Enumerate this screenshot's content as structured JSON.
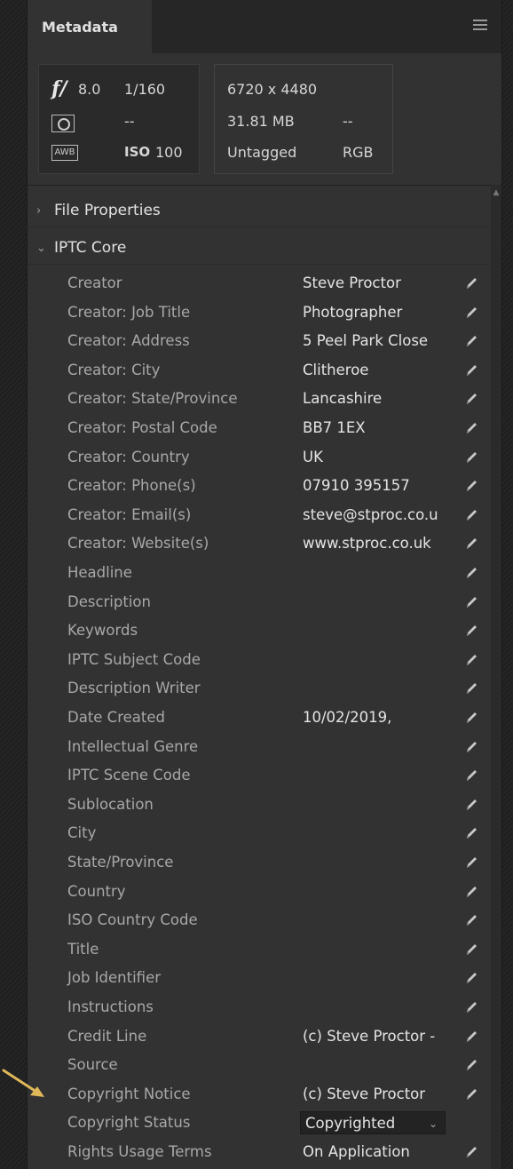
{
  "panel": {
    "tab_label": "Metadata",
    "menu_icon": "hamburger-menu-icon"
  },
  "summary": {
    "exif": {
      "aperture_symbol": "f/",
      "aperture": "8.0",
      "shutter": "1/160",
      "metering": "--",
      "white_balance": "AWB",
      "iso_label": "ISO",
      "iso": "100"
    },
    "file": {
      "dimensions": "6720 x 4480",
      "size": "31.81 MB",
      "size_extra": "--",
      "profile": "Untagged",
      "color_mode": "RGB"
    }
  },
  "sections": [
    {
      "label": "File Properties",
      "expanded": false
    },
    {
      "label": "IPTC Core",
      "expanded": true
    }
  ],
  "fields": [
    {
      "label": "Creator",
      "value": "Steve Proctor"
    },
    {
      "label": "Creator: Job Title",
      "value": "Photographer"
    },
    {
      "label": "Creator: Address",
      "value": "5 Peel Park Close"
    },
    {
      "label": "Creator: City",
      "value": "Clitheroe"
    },
    {
      "label": "Creator: State/Province",
      "value": "Lancashire"
    },
    {
      "label": "Creator: Postal Code",
      "value": "BB7 1EX"
    },
    {
      "label": "Creator: Country",
      "value": "UK"
    },
    {
      "label": "Creator: Phone(s)",
      "value": "07910 395157"
    },
    {
      "label": "Creator: Email(s)",
      "value": "steve@stproc.co.u"
    },
    {
      "label": "Creator: Website(s)",
      "value": "www.stproc.co.uk"
    },
    {
      "label": "Headline",
      "value": ""
    },
    {
      "label": "Description",
      "value": ""
    },
    {
      "label": "Keywords",
      "value": ""
    },
    {
      "label": "IPTC Subject Code",
      "value": ""
    },
    {
      "label": "Description Writer",
      "value": ""
    },
    {
      "label": "Date Created",
      "value": "10/02/2019,"
    },
    {
      "label": "Intellectual Genre",
      "value": ""
    },
    {
      "label": "IPTC Scene Code",
      "value": ""
    },
    {
      "label": "Sublocation",
      "value": ""
    },
    {
      "label": "City",
      "value": ""
    },
    {
      "label": "State/Province",
      "value": ""
    },
    {
      "label": "Country",
      "value": ""
    },
    {
      "label": "ISO Country Code",
      "value": ""
    },
    {
      "label": "Title",
      "value": ""
    },
    {
      "label": "Job Identifier",
      "value": ""
    },
    {
      "label": "Instructions",
      "value": ""
    },
    {
      "label": "Credit Line",
      "value": "(c) Steve Proctor -"
    },
    {
      "label": "Source",
      "value": ""
    },
    {
      "label": "Copyright Notice",
      "value": "(c) Steve Proctor"
    },
    {
      "label": "Copyright Status",
      "value": "Copyrighted",
      "type": "select"
    },
    {
      "label": "Rights Usage Terms",
      "value": "On Application"
    }
  ],
  "colors": {
    "annotation_arrow": "#e0b85a"
  }
}
